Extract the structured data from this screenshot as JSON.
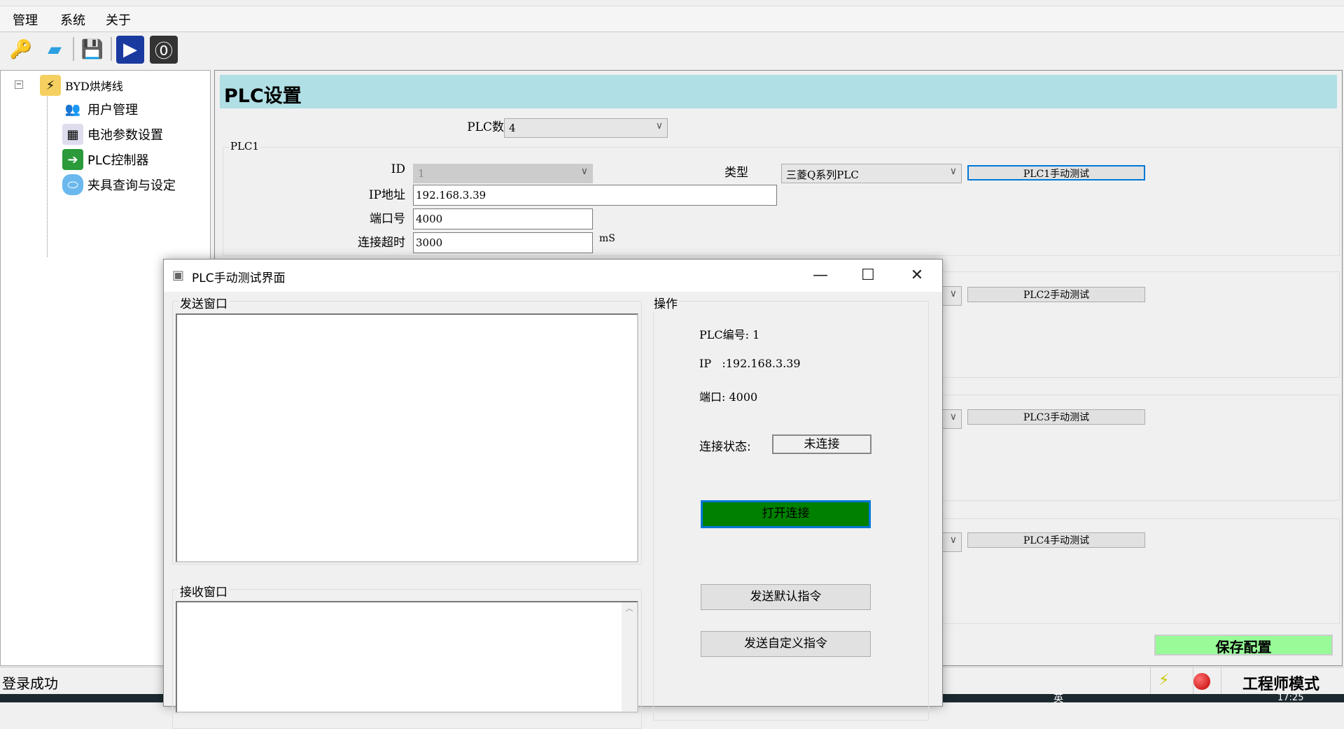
{
  "menu": [
    "管理",
    "系统",
    "关于"
  ],
  "toolbar": {
    "icons": [
      "key-icon",
      "monitor-icon",
      "save-icon",
      "play-icon",
      "power-icon"
    ]
  },
  "tree": {
    "root": "BYD烘烤线",
    "items": [
      "用户管理",
      "电池参数设置",
      "PLC控制器",
      "夹具查询与设定"
    ]
  },
  "main": {
    "title": "PLC设置",
    "plc_count_label": "PLC数量",
    "plc_count_value": "4",
    "plc1": {
      "group": "PLC1",
      "id_label": "ID",
      "id_value": "1",
      "type_label": "类型",
      "type_value": "三菱Q系列PLC",
      "test_button": "PLC1手动测试",
      "ip_label": "IP地址",
      "ip_value": "192.168.3.39",
      "port_label": "端口号",
      "port_value": "4000",
      "timeout_label": "连接超时",
      "timeout_value": "3000",
      "timeout_unit": "mS"
    },
    "plc2_button": "PLC2手动测试",
    "plc3_button": "PLC3手动测试",
    "plc4_button": "PLC4手动测试",
    "save_button": "保存配置"
  },
  "status": {
    "left": "登录成功",
    "mode": "工程师模式"
  },
  "dialog": {
    "title": "PLC手动测试界面",
    "send_group": "发送窗口",
    "recv_group": "接收窗口",
    "op_group": "操作",
    "plc_no": "PLC编号: 1",
    "ip": "IP   :192.168.3.39",
    "port": "端口: 4000",
    "conn_label": "连接状态:",
    "conn_value": "未连接",
    "open_button": "打开连接",
    "send_default": "发送默认指令",
    "send_custom": "发送自定义指令"
  },
  "taskbar": {
    "ime": "英",
    "clock": "17:25"
  },
  "colors": {
    "header": "#b0dfe5",
    "open_button": "#008000",
    "save_button": "#98fb98"
  }
}
